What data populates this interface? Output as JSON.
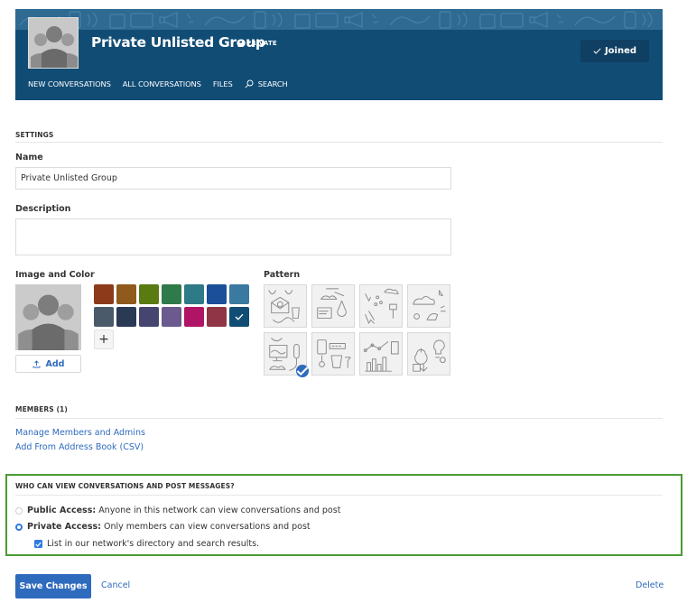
{
  "header": {
    "group_name": "Private Unlisted Group",
    "privacy_badge": "PRIVATE",
    "joined_label": "Joined",
    "brand_color": "#114c74",
    "nav": [
      {
        "label": "NEW CONVERSATIONS",
        "icon": null
      },
      {
        "label": "ALL CONVERSATIONS",
        "icon": null
      },
      {
        "label": "FILES",
        "icon": null
      },
      {
        "label": "SEARCH",
        "icon": "search-icon"
      }
    ]
  },
  "settings": {
    "section_title": "SETTINGS",
    "name_label": "Name",
    "name_value": "Private Unlisted Group",
    "description_label": "Description",
    "description_value": "",
    "image_color_label": "Image and Color",
    "add_image_label": "Add",
    "pattern_label": "Pattern",
    "colors": [
      "#8d3a1a",
      "#8f5a1c",
      "#5a7a12",
      "#2f7a4a",
      "#2e7a86",
      "#1b4f9a",
      "#3a7aa0",
      "#4a5a6a",
      "#2a3a55",
      "#454570",
      "#6a5a8e",
      "#b01565",
      "#8f3545",
      "#114c74"
    ],
    "selected_color_index": 13,
    "patterns": [
      "mail-coffee",
      "laptop-science",
      "ideas-pushpin",
      "cloud-bird",
      "monitor-mic",
      "phone-coffee",
      "chart-graph",
      "apple-bulb"
    ],
    "selected_pattern_index": 4
  },
  "members": {
    "section_title": "MEMBERS (1)",
    "links": [
      "Manage Members and Admins",
      "Add From Address Book (CSV)"
    ]
  },
  "access": {
    "section_title": "WHO CAN VIEW CONVERSATIONS AND POST MESSAGES?",
    "options": [
      {
        "title": "Public Access:",
        "desc": "Anyone in this network can view conversations and post",
        "selected": false
      },
      {
        "title": "Private Access:",
        "desc": "Only members can view conversations and post",
        "selected": true
      }
    ],
    "list_in_directory_label": "List in our network's directory and search results.",
    "list_in_directory_checked": true
  },
  "footer": {
    "save_label": "Save Changes",
    "cancel_label": "Cancel",
    "delete_label": "Delete"
  }
}
